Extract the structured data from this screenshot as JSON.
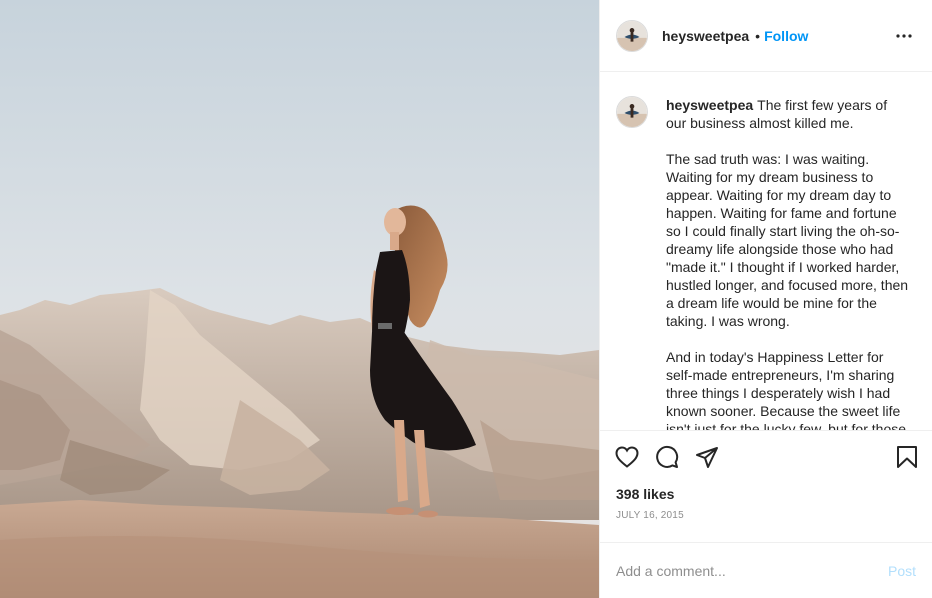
{
  "header": {
    "username": "heysweetpea",
    "separator": "•",
    "follow_label": "Follow",
    "more_icon": "more-horizontal-icon"
  },
  "caption": {
    "username": "heysweetpea",
    "first_line": "The first few years of our business almost killed me.",
    "paragraph_2": "The sad truth was: I was waiting. Waiting for my dream business to appear. Waiting for my dream day to happen. Waiting for fame and fortune so I could finally start living the oh-so-dreamy life alongside those who had \"made it.\" I thought if I worked harder, hustled longer, and focused more, then a dream life would be mine for the taking. I was wrong.",
    "paragraph_3": "And in today's Happiness Letter for self-made entrepreneurs, I'm sharing three things I desperately wish I had known sooner. Because the sweet life isn't just for the lucky few, but for those who dare to seek it."
  },
  "actions": {
    "like_icon": "heart-icon",
    "comment_icon": "comment-icon",
    "share_icon": "share-icon",
    "save_icon": "bookmark-icon"
  },
  "likes_text": "398 likes",
  "date_text": "JULY 16, 2015",
  "comment_input": {
    "placeholder": "Add a comment...",
    "post_label": "Post"
  },
  "colors": {
    "link_blue": "#0095f6",
    "post_disabled": "#b2dffc",
    "muted": "#8e8e8e",
    "border": "#efefef"
  }
}
